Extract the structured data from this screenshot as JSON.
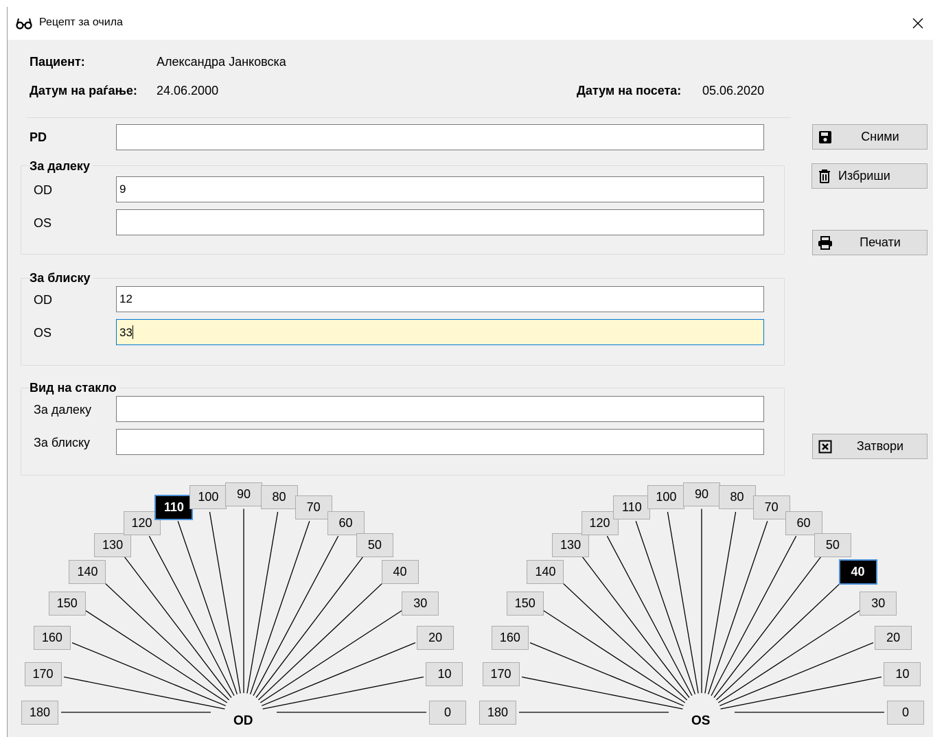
{
  "window": {
    "title": "Рецепт за очила",
    "icon": "glasses-icon"
  },
  "patient": {
    "patient_label": "Пациент:",
    "patient_name": "Александра Јанковска",
    "dob_label": "Датум на раѓање:",
    "dob_value": "24.06.2000",
    "visit_label": "Датум на посета:",
    "visit_value": "05.06.2020"
  },
  "form": {
    "pd_label": "PD",
    "pd_value": "",
    "far": {
      "title": "За далеку",
      "od_label": "OD",
      "od_value": "9",
      "os_label": "OS",
      "os_value": ""
    },
    "near": {
      "title": "За блиску",
      "od_label": "OD",
      "od_value": "12",
      "os_label": "OS",
      "os_value": "33"
    },
    "glass": {
      "title": "Вид на стакло",
      "far_label": "За далеку",
      "far_value": "",
      "near_label": "За блиску",
      "near_value": ""
    }
  },
  "buttons": {
    "save": "Сними",
    "delete": "Избриши",
    "print": "Печати",
    "close": "Затвори"
  },
  "axis_charts": [
    {
      "eye": "OD",
      "angles": [
        "180",
        "170",
        "160",
        "150",
        "140",
        "130",
        "120",
        "110",
        "100",
        "90",
        "80",
        "70",
        "60",
        "50",
        "40",
        "30",
        "20",
        "10",
        "0"
      ],
      "selected": "110"
    },
    {
      "eye": "OS",
      "angles": [
        "180",
        "170",
        "160",
        "150",
        "140",
        "130",
        "120",
        "110",
        "100",
        "90",
        "80",
        "70",
        "60",
        "50",
        "40",
        "30",
        "20",
        "10",
        "0"
      ],
      "selected": "40"
    }
  ]
}
